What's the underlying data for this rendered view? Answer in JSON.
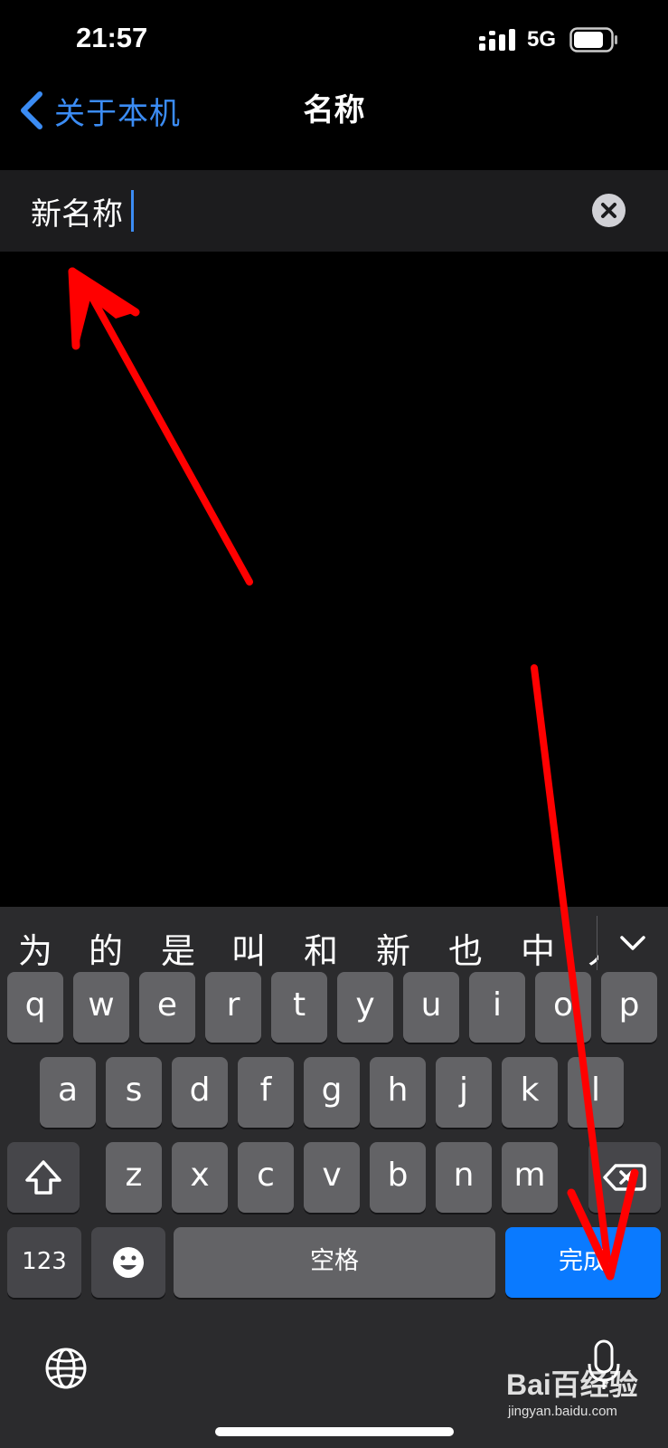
{
  "status_bar": {
    "time": "21:57",
    "network": "5G"
  },
  "nav": {
    "back_label": "关于本机",
    "title": "名称"
  },
  "name_field": {
    "value": "新名称"
  },
  "keyboard": {
    "candidates": [
      "为",
      "的",
      "是",
      "叫",
      "和",
      "新",
      "也",
      "中",
      "人"
    ],
    "row1": [
      "q",
      "w",
      "e",
      "r",
      "t",
      "y",
      "u",
      "i",
      "o",
      "p"
    ],
    "row2": [
      "a",
      "s",
      "d",
      "f",
      "g",
      "h",
      "j",
      "k",
      "l"
    ],
    "row3": [
      "z",
      "x",
      "c",
      "v",
      "b",
      "n",
      "m"
    ],
    "numbers_label": "123",
    "space_label": "空格",
    "done_label": "完成"
  },
  "watermark": {
    "brand": "Bai百经验",
    "site": "jingyan.baidu.com"
  },
  "colors": {
    "accent": "#3b8cf4",
    "done_key": "#0a7aff",
    "annotation_arrow": "#ff0000"
  }
}
